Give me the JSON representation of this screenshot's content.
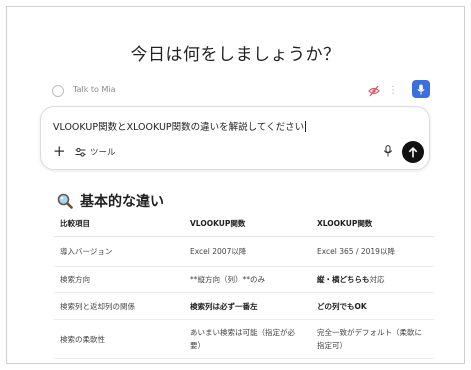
{
  "title": "今日は何をしましょうか？",
  "talk": {
    "label": "Talk to Mia"
  },
  "prompt": {
    "text": "VLOOKUP関数とXLOOKUP関数の違いを解説してください"
  },
  "toolbar": {
    "tools_label": "ツール"
  },
  "colors": {
    "accent_blue": "#3b6fe0",
    "send_button": "#111111",
    "eye_slash_red": "#e0526a"
  },
  "section": {
    "heading": "基本的な違い",
    "icon": "magnifier-icon"
  },
  "table": {
    "headers": [
      "比較項目",
      "VLOOKUP関数",
      "XLOOKUP関数"
    ],
    "rows": [
      [
        "導入バージョン",
        "Excel 2007以降",
        "Excel 365 / 2019以降"
      ],
      [
        "検索方向",
        "**縦方向（列）**のみ",
        "縦・横どちらも対応"
      ],
      [
        "検索列と返却列の関係",
        "検索列は必ず一番左",
        "どの列でもOK"
      ],
      [
        "検索の柔軟性",
        "あいまい検索は可能（指定が必要）",
        "完全一致がデフォルト（柔軟に指定可）"
      ]
    ],
    "bold_parts": {
      "row1_col2": "縦・横どちらも",
      "row1_col2_rest": "対応"
    }
  }
}
